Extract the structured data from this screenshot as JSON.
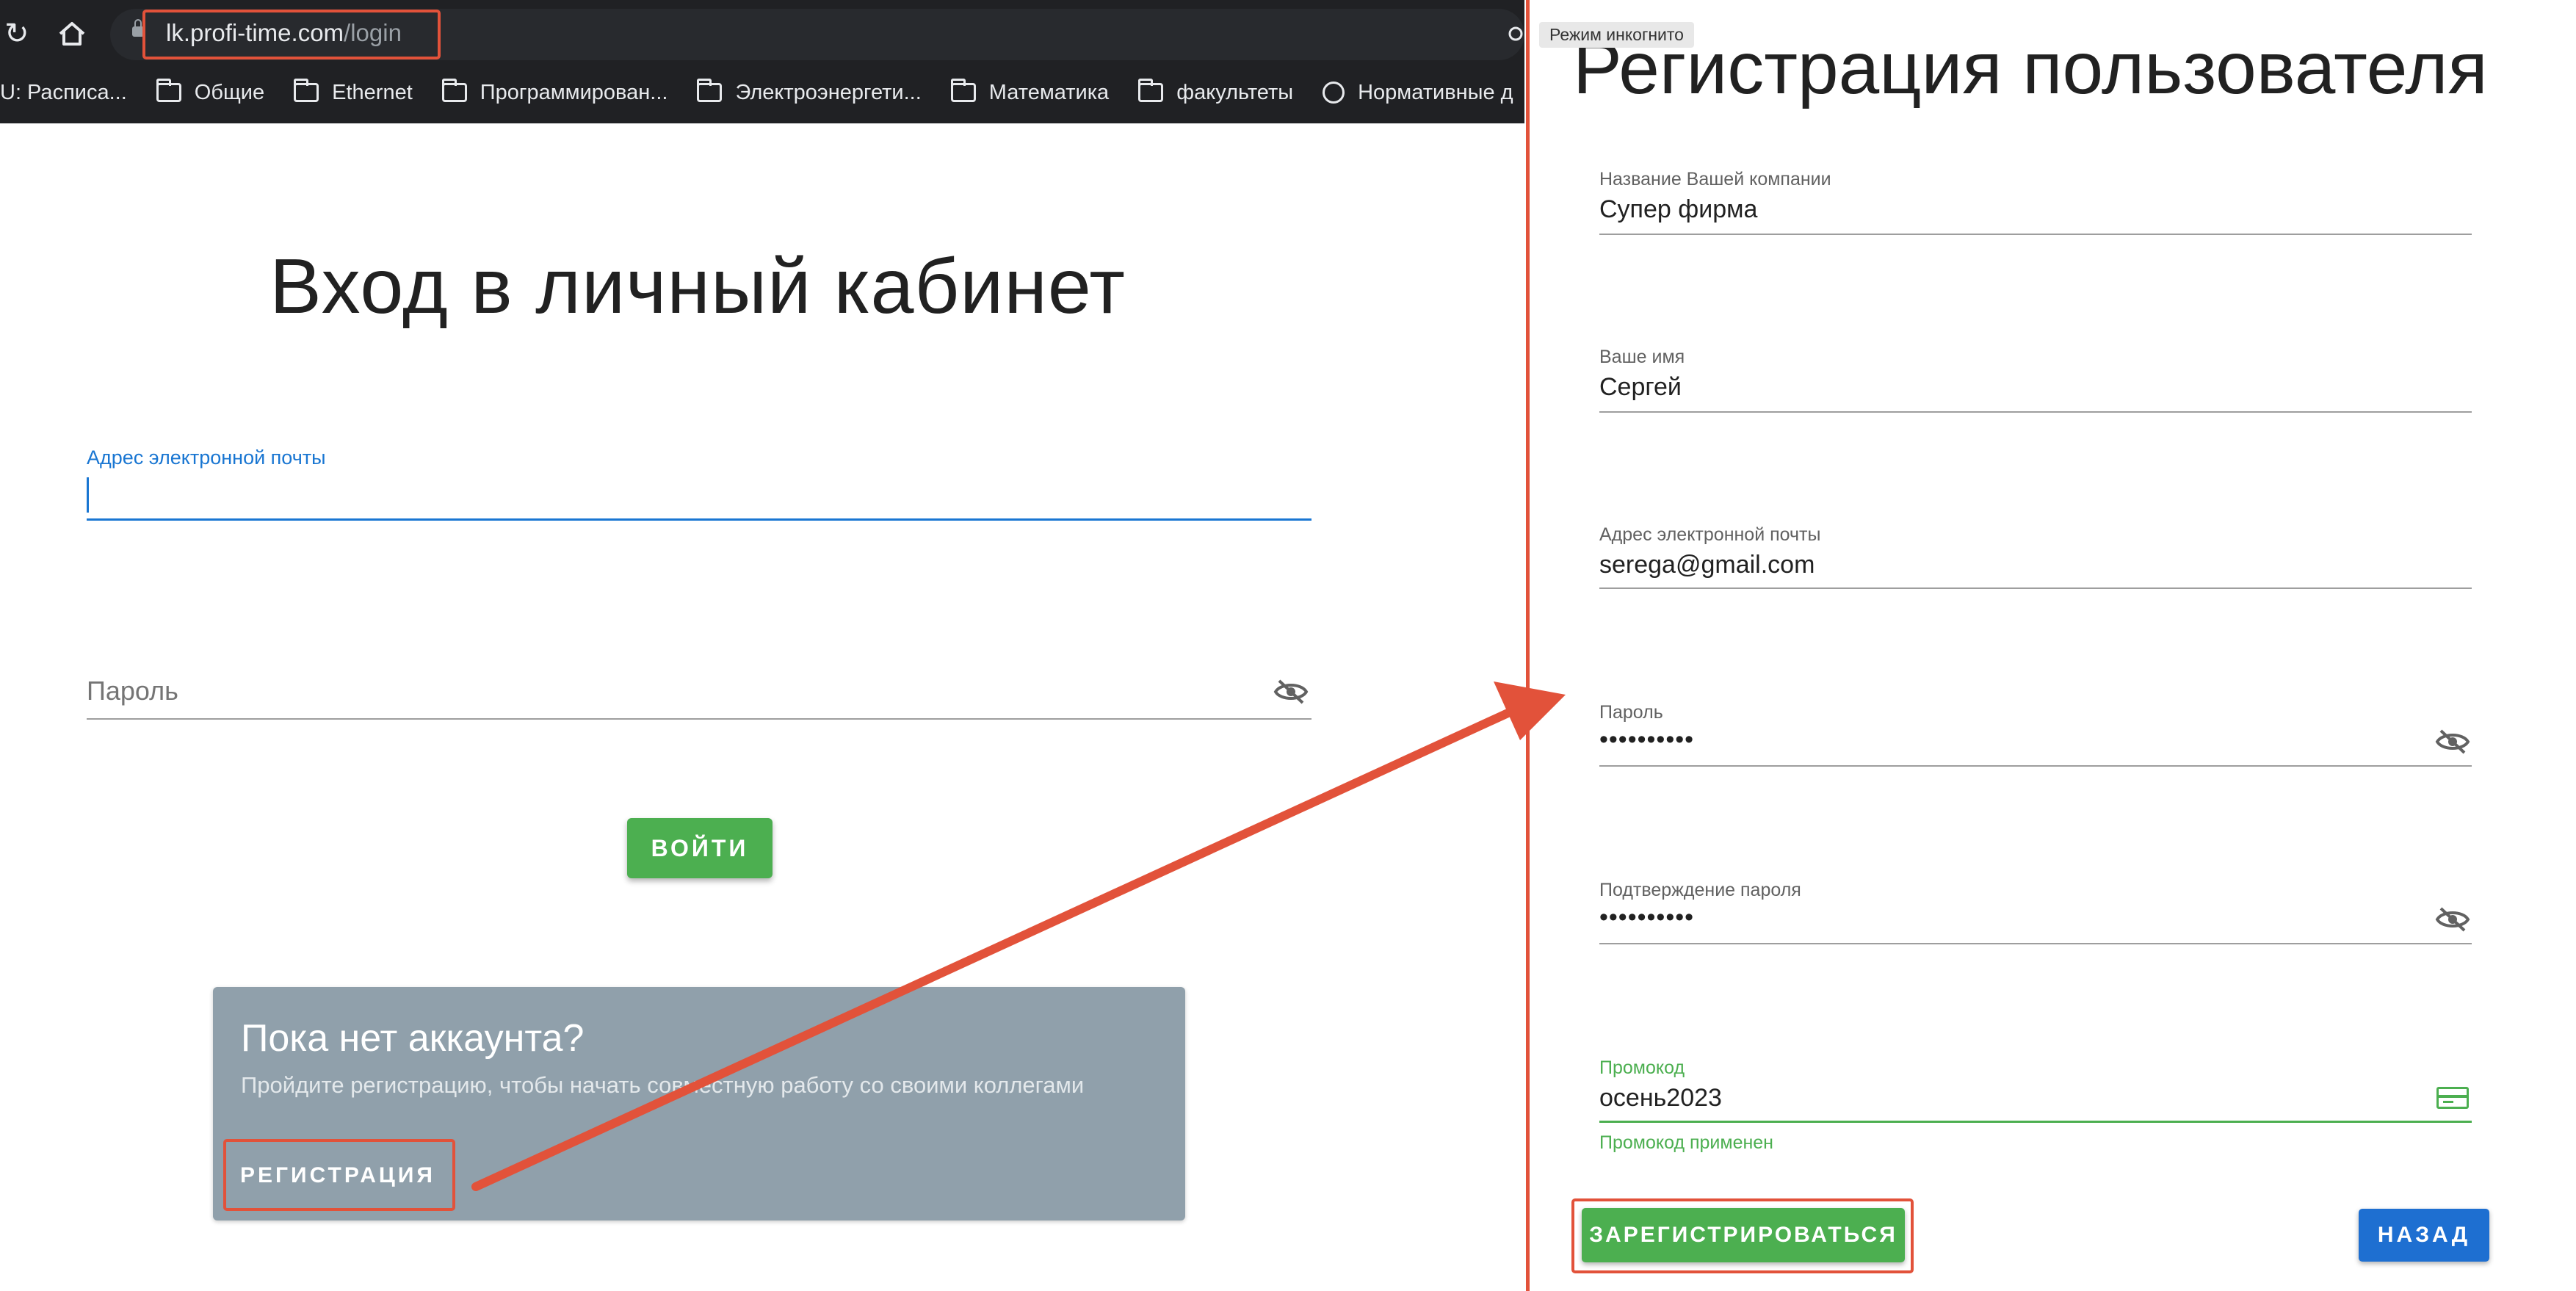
{
  "browser": {
    "url_host": "lk.profi-time.com",
    "url_path": "/login",
    "bookmarks": [
      {
        "label": "U: Расписа...",
        "icon": "none"
      },
      {
        "label": "Общие",
        "icon": "folder-icon"
      },
      {
        "label": "Ethernet",
        "icon": "folder-icon"
      },
      {
        "label": "Программирован...",
        "icon": "folder-icon"
      },
      {
        "label": "Электроэнергети...",
        "icon": "folder-icon"
      },
      {
        "label": "Математика",
        "icon": "folder-icon"
      },
      {
        "label": "факультеты",
        "icon": "folder-icon"
      },
      {
        "label": "Нормативные д",
        "icon": "globe-icon"
      }
    ]
  },
  "login": {
    "title": "Вход в личный кабинет",
    "email_label": "Адрес электронной почты",
    "email_value": "",
    "password_label": "Пароль",
    "login_button": "ВОЙТИ",
    "promo_title": "Пока нет аккаунта?",
    "promo_subtitle": "Пройдите регистрацию, чтобы начать совместную работу со своими коллегами",
    "register_button": "РЕГИСТРАЦИЯ"
  },
  "registration": {
    "incognito_label": "Режим инкогнито",
    "title": "Регистрация пользователя",
    "fields": {
      "company": {
        "label": "Название Вашей компании",
        "value": "Супер фирма"
      },
      "name": {
        "label": "Ваше имя",
        "value": "Сергей"
      },
      "email": {
        "label": "Адрес электронной почты",
        "value": "serega@gmail.com"
      },
      "password": {
        "label": "Пароль",
        "value": "••••••••••"
      },
      "password_confirm": {
        "label": "Подтверждение пароля",
        "value": "••••••••••"
      },
      "promo": {
        "label": "Промокод",
        "value": "осень2023",
        "helper": "Промокод применен"
      }
    },
    "submit_button": "ЗАРЕГИСТРИРОВАТЬСЯ",
    "back_button": "НАЗАД"
  },
  "colors": {
    "annotation": "#e2523a",
    "primary_green": "#4caf50",
    "primary_blue": "#1e6fd1",
    "card_gray": "#90a0ab"
  }
}
